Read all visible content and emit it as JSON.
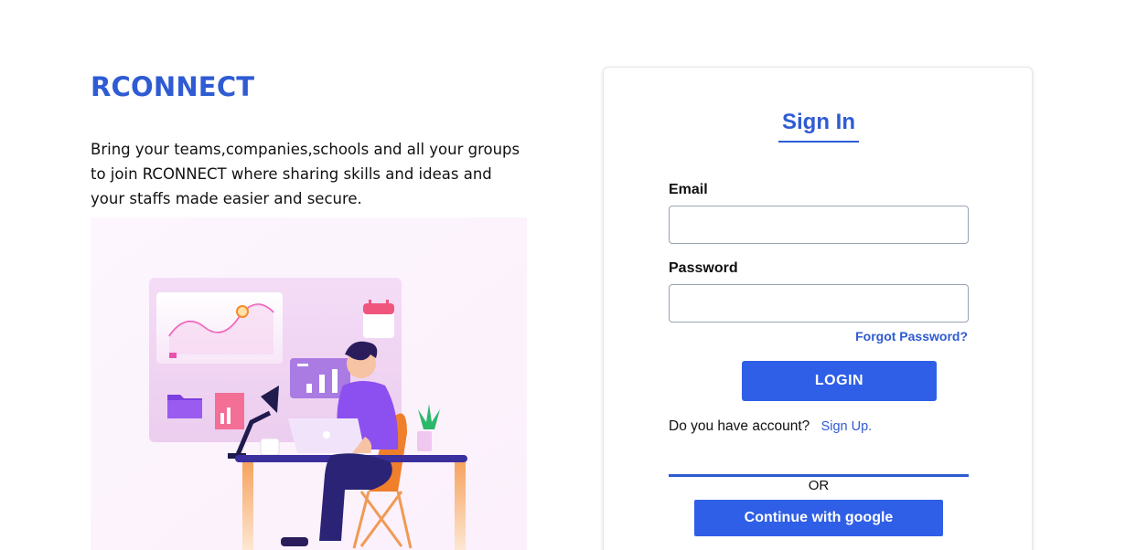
{
  "brand": {
    "name": "RCONNECT"
  },
  "hero": {
    "tagline": "Bring your teams,companies,schools and all your groups to join RCONNECT where sharing skills and ideas and your staffs made easier and secure."
  },
  "signin": {
    "title": "Sign In",
    "email_label": "Email",
    "email_value": "",
    "password_label": "Password",
    "password_value": "",
    "forgot_label": "Forgot Password?",
    "login_label": "LOGIN",
    "account_prompt": "Do you have account?",
    "signup_label": "Sign Up.",
    "or_label": "OR",
    "google_label": "Continue with google"
  },
  "colors": {
    "accent": "#2f5bd3",
    "button": "#2f5fe6",
    "illustration_purple": "#8b5cf6",
    "illustration_orange": "#f59e5b"
  },
  "icons": [
    "workspace-illustration"
  ]
}
